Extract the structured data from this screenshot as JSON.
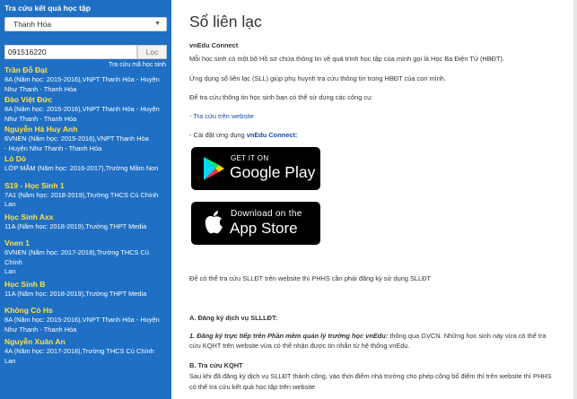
{
  "sidebar": {
    "title": "Tra cứu kết quả học tập",
    "province": "Thanh Hóa",
    "search_value": "091516220",
    "search_button": "Lọc",
    "lookup_link": "Tra cứu mã học sinh",
    "students": [
      {
        "name": "Trần Đỗ Đạt",
        "line1": "8A (Năm học: 2015-2016),VNPT Thanh Hóa - Huyện",
        "line2": "Như Thanh - Thanh Hóa"
      },
      {
        "name": "Đào Việt Đức",
        "line1": "8A (Năm học: 2015-2016),VNPT Thanh Hóa - Huyện",
        "line2": "Như Thanh - Thanh Hóa"
      },
      {
        "name": "Nguyễn Hà Huy Anh",
        "line1": "6VNEN (Năm học: 2015-2016),VNPT Thanh Hóa",
        "line2": "- Huyện Như Thanh - Thanh Hóa"
      },
      {
        "name": "Lò Dò",
        "line1": "LỚP MẦM (Năm học: 2016-2017),Trường Mầm Non",
        "line2": ""
      },
      {
        "name": "S19 - Học Sinh 1",
        "line1": "7A1 (Năm học: 2018-2019),Trường THCS Cù Chính",
        "line2": "Lan"
      },
      {
        "name": "Học Sinh Axx",
        "line1": "11A (Năm học: 2018-2019),Trường THPT Media",
        "line2": ""
      },
      {
        "name": "Vnen 1",
        "line1": "6VNEN (Năm học: 2017-2018),Trường THCS Cù Chính",
        "line2": "Lan"
      },
      {
        "name": "Học Sinh B",
        "line1": "11A (Năm học: 2018-2019),Trường THPT Media",
        "line2": ""
      },
      {
        "name": "Không Có Hs",
        "line1": "8A (Năm học: 2015-2016),VNPT Thanh Hóa - Huyện",
        "line2": "Như Thanh - Thanh Hóa"
      },
      {
        "name": "Nguyễn Xuân An",
        "line1": "4A (Năm học: 2017-2018),Trường THCS Cù Chính",
        "line2": "Lan"
      }
    ]
  },
  "main": {
    "title": "Sổ liên lạc",
    "subtitle": "vnEdu Connect",
    "intro": "Mỗi học sinh có một bộ Hồ sơ chứa thông tin về quá trình học tập của mình gọi là Học Bạ Điện Tử (HBĐT).",
    "app_desc": "Ứng dụng sổ liên lạc (SLL) giúp phụ huynh tra cứu thông tin trong HBĐT của con mình.",
    "tools_intro": "Để tra cứu thông tin học sinh bạn có thể sử dụng các công cụ:",
    "web_link": "- Tra cứu trên website",
    "install_prefix": "- Cài đặt ứng dụng ",
    "install_app": "vnEdu Connect:",
    "google_play": {
      "small": "GET IT ON",
      "big": "Google Play"
    },
    "app_store": {
      "small": "Download on the",
      "big": "App Store"
    },
    "register_note": "Để có thể tra cứu SLLĐT trên website thì PHHS cần phải đăng ký sử dụng SLLĐT",
    "section_a": "A. Đăng ký dịch vụ SLLLĐT:",
    "section_a_em": "1. Đăng ký trực tiếp trên Phần mềm quản lý trường học vnEdu:",
    "section_a_text": " thông qua GVCN. Những học sinh này vừa có thể tra",
    "section_a_text2": "cứu KQHT trên website vừa có thể nhận được tin nhắn từ hệ thống vnEdu.",
    "section_b": "B. Tra cứu KQHT",
    "section_b_text": "Sau khi đã đăng ký dịch vụ SLLĐT thành công, vào thời điểm nhà trường cho phép công bố điểm thì trên website thì PHHS",
    "section_b_text2": "có thể tra cứu kết quả học tập trên website"
  },
  "colors": {
    "sidebar_bg": "#1f6fc4",
    "student_name": "#ffe14a",
    "link": "#1a4ea8"
  },
  "icons": [
    "caret-down-icon",
    "google-play-icon",
    "apple-icon"
  ]
}
